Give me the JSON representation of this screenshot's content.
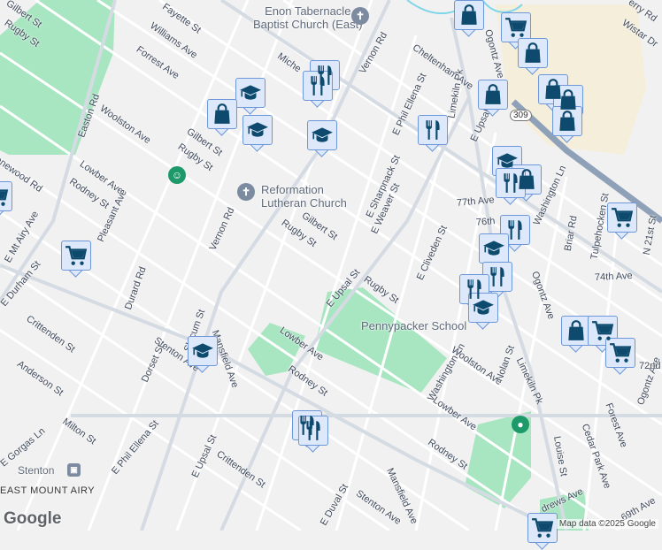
{
  "map": {
    "streets": [
      "Fayette St",
      "Williams Ave",
      "Forrest Ave",
      "Vernon Rd",
      "Miche",
      "Cheltenham Ave",
      "Easton Rd",
      "Woolston Ave",
      "Lowber Ave",
      "Rodney St",
      "Pleasant Ave",
      "Gilbert St",
      "Rugby St",
      "Gilbert St",
      "Rugby St",
      "Vernon Rd",
      "E Phil Ellena St",
      "E Sharpnack St",
      "E Weaver St",
      "E Upsal St",
      "Rugby St",
      "E Cliveden St",
      "77th Ave",
      "76th",
      "Washington Ln",
      "Briar Rd",
      "Tulpehocken St",
      "N 21st St",
      "74th Ave",
      "Ogontz Ave",
      "Washington Ln",
      "Woolston Ave",
      "Nolan St",
      "Lowber Ave",
      "Lowber Ave",
      "Rodney St",
      "Rodney St",
      "Mansfield Ave",
      "Mansfield Ave",
      "Stenton Ave",
      "Stenton Ave",
      "Durard Rd",
      "Slocum St",
      "Dorset St",
      "Crittenden St",
      "Anderson St",
      "Milton St",
      "E Phil Ellena St",
      "E Upsal St",
      "Crittenden St",
      "E Durham St",
      "E Mt Airy Ave",
      "Lynnewood Rd",
      "E Gorgas Ln",
      "E Duval St",
      "Forest Ave",
      "Cedar Park Ave",
      "Louise St",
      "Ogontz Ave",
      "Limekiln Pk",
      "Wistar Dr",
      "erry Rd",
      "72nd",
      "69th Ave",
      "drews Ave",
      "Ogontz Ave",
      "E Upsal St",
      "Limekiln Pk",
      "Gilbert St",
      "Rugby St"
    ],
    "pois": {
      "enon_line1": "Enon Tabernacle",
      "enon_line2": "Baptist Church (East)",
      "reformation_line1": "Reformation",
      "reformation_line2": "Lutheran Church",
      "pennypacker": "Pennypacker School",
      "stenton": "Stenton"
    },
    "region": "EAST MOUNT AIRY",
    "route_shield": "309",
    "attribution": "Map data ©2025 Google",
    "logo": "Google",
    "marker_color": "#0d4a6e",
    "marker_bg": "#dde8fb",
    "park_color": "#a8e6c1",
    "mall_color": "#f5eedb"
  }
}
